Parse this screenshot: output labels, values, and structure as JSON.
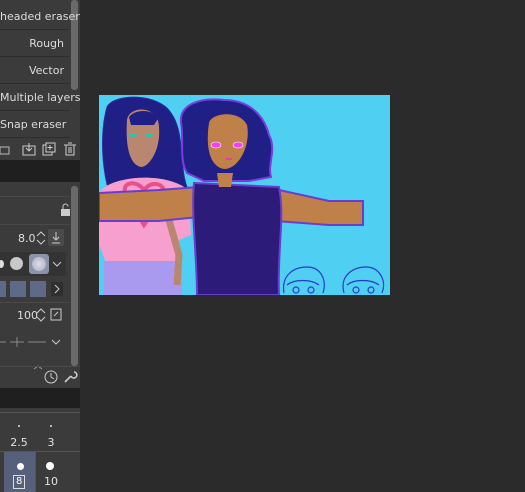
{
  "tool_panel": {
    "sub_tools": [
      {
        "label": "headed eraser"
      },
      {
        "label": "Rough"
      },
      {
        "label": "Vector"
      },
      {
        "label": "Multiple layers"
      },
      {
        "label": "Snap eraser"
      }
    ]
  },
  "tool_property": {
    "brush_size_value": "8.0",
    "opacity_value": "100"
  },
  "brush_size_palette": {
    "sizes": [
      "2.5",
      "3",
      "8",
      "10"
    ],
    "selected": "8"
  },
  "icons": [
    "download-icon",
    "duplicate-icon",
    "trash-icon",
    "lock-icon",
    "pressure-icon",
    "chevron-down-icon",
    "chevron-right-icon",
    "settings-icon",
    "wrench-icon"
  ],
  "colors": {
    "canvas_background": "#4fd0f2",
    "panel": "#3b3b3b",
    "workspace": "#2b2b2b"
  }
}
